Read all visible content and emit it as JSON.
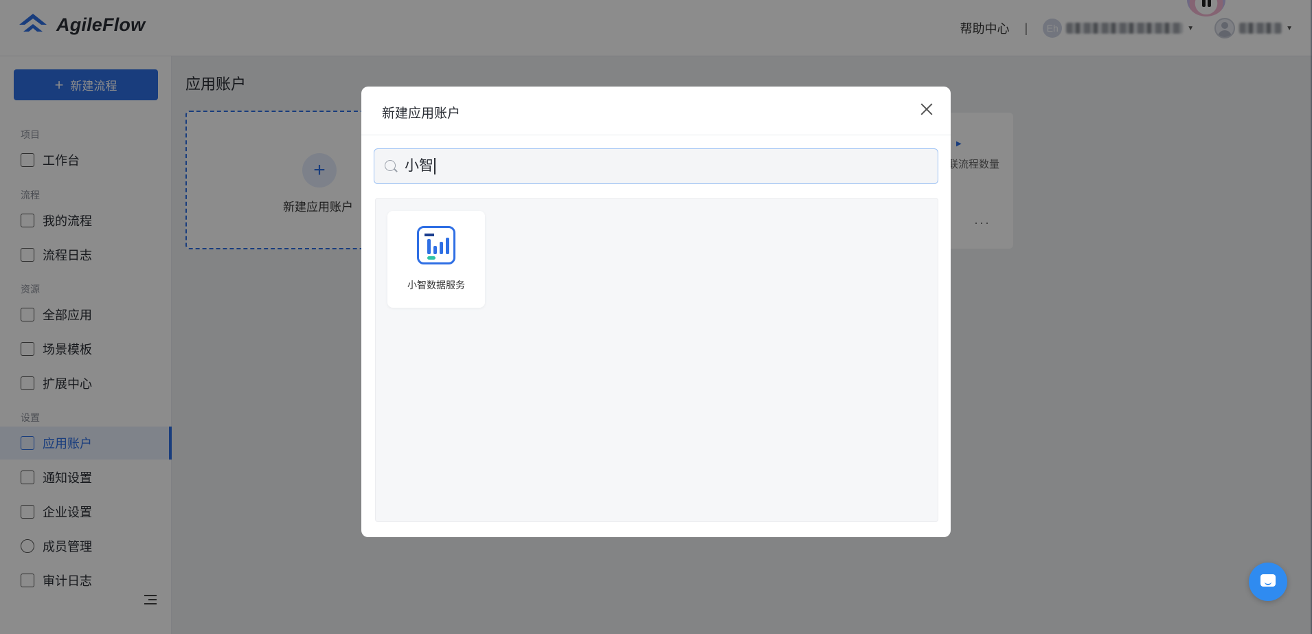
{
  "header": {
    "logo_text": "AgileFlow",
    "help_link": "帮助中心",
    "divider": "|",
    "org_avatar_text": "Eh"
  },
  "sidebar": {
    "new_flow_button": "新建流程",
    "sections": {
      "project": "项目",
      "flow": "流程",
      "resources": "资源",
      "settings": "设置"
    },
    "items": [
      {
        "label": "工作台",
        "icon": "dashboard-icon"
      },
      {
        "label": "我的流程",
        "icon": "chart-icon"
      },
      {
        "label": "流程日志",
        "icon": "calendar-icon"
      },
      {
        "label": "全部应用",
        "icon": "grid-icon"
      },
      {
        "label": "场景模板",
        "icon": "template-icon"
      },
      {
        "label": "扩展中心",
        "icon": "puzzle-icon"
      },
      {
        "label": "应用账户",
        "icon": "account-card-icon",
        "active": true
      },
      {
        "label": "通知设置",
        "icon": "notification-icon"
      },
      {
        "label": "企业设置",
        "icon": "company-icon"
      },
      {
        "label": "成员管理",
        "icon": "member-icon"
      },
      {
        "label": "审计日志",
        "icon": "audit-icon"
      }
    ]
  },
  "main": {
    "page_title": "应用账户",
    "add_account_label": "新建应用账户",
    "account_card": {
      "flow_count_label": "联流程数量",
      "more": "···"
    }
  },
  "modal": {
    "title": "新建应用账户",
    "search_value": "小智",
    "results": [
      {
        "name": "小智数据服务",
        "icon": "xiaozhi-data-service-logo"
      }
    ]
  },
  "colors": {
    "accent": "#2f6fe4",
    "chat_button": "#2f8bf0"
  }
}
